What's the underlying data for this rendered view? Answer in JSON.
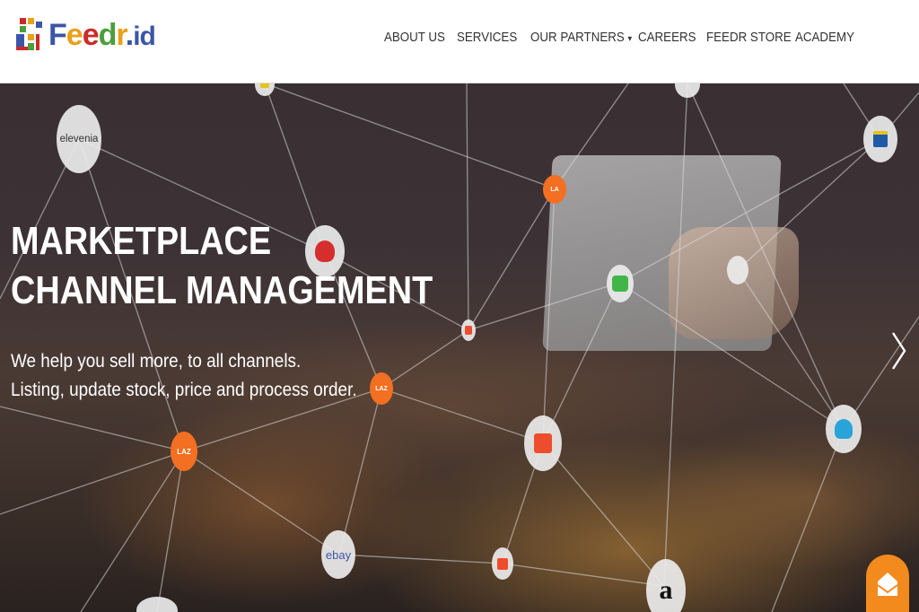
{
  "brand": {
    "logo_text_parts": [
      "F",
      "e",
      "e",
      "d",
      "r",
      ".",
      "id"
    ],
    "logo_alt": "Feedr.id"
  },
  "nav": {
    "items": [
      {
        "label": "ABOUT US"
      },
      {
        "label": "SERVICES"
      },
      {
        "label": "OUR PARTNERS",
        "dropdown": true
      },
      {
        "label": "CAREERS"
      },
      {
        "label": "FEEDR STORE"
      },
      {
        "label": "ACADEMY"
      }
    ],
    "caret": "▾"
  },
  "hero": {
    "title_line1": "MARKETPLACE",
    "title_line2": "CHANNEL MANAGEMENT",
    "subtitle_line1": "We help you sell more, to all channels.",
    "subtitle_line2": "Listing, update stock, price and process order.",
    "next_icon": "chevron-right-icon"
  },
  "partners": {
    "elevenia": "elevenia",
    "ebay": "ebay",
    "amazon": "a",
    "lazada": "LAZ"
  },
  "colors": {
    "nav_text": "#333333",
    "hero_text": "#ffffff",
    "chat_button": "#f28a1e",
    "shopee": "#ee4d2d",
    "lazada": "#f36f21",
    "tokopedia": "#42b549"
  }
}
